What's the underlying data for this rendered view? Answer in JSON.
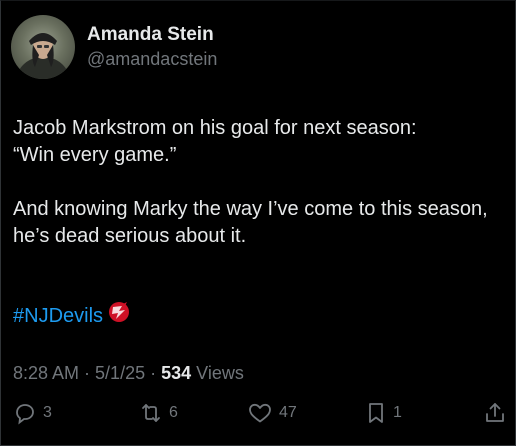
{
  "author": {
    "display_name": "Amanda Stein",
    "handle": "@amandacstein"
  },
  "tweet": {
    "paragraph1": "Jacob Markstrom on his goal for next season:\n“Win every game.”",
    "paragraph2": "And knowing Marky the way I’ve come to this season, he’s dead serious about it.",
    "hashtag": "#NJDevils",
    "hashtag_emoji": "nj-devils-logo-icon"
  },
  "meta": {
    "time": "8:28 AM",
    "sep1": "·",
    "date": "5/1/25",
    "sep2": "·",
    "views_count": "534",
    "views_label": "Views"
  },
  "actions": {
    "replies": "3",
    "reposts": "6",
    "likes": "47",
    "bookmarks": "1"
  },
  "colors": {
    "background": "#000000",
    "text": "#e7e9ea",
    "muted": "#71767b",
    "link": "#1d9bf0",
    "devils_red": "#ce1126"
  }
}
